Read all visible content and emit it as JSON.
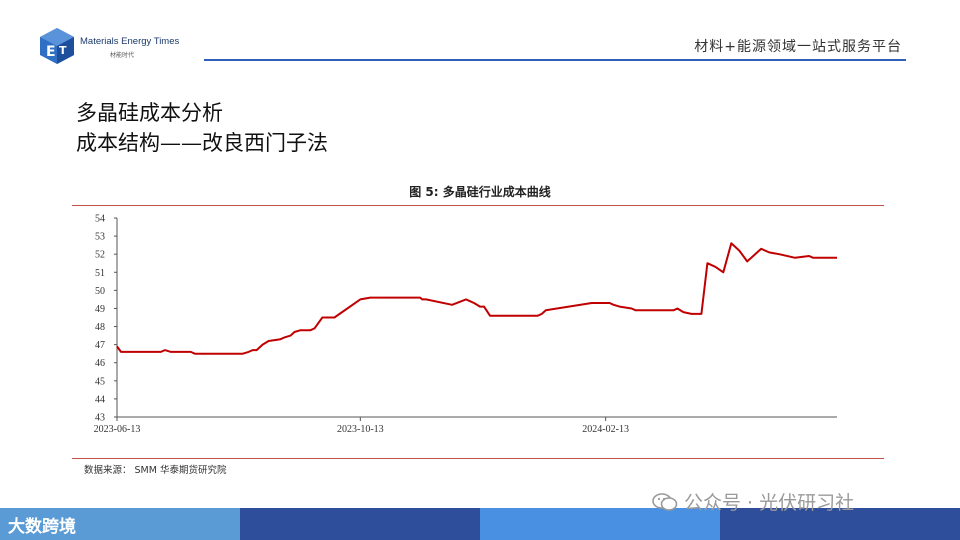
{
  "header": {
    "brand_en": "Materials Energy Times",
    "brand_cn": "材能时代",
    "tagline": "材料+能源领域一站式服务平台"
  },
  "slide": {
    "title_line1": "多晶硅成本分析",
    "title_line2": "成本结构——改良西门子法"
  },
  "footer": {
    "source": "数据来源：   SMM  华泰期货研究院",
    "logo_text": "大数跨境",
    "watermark": "公众号 · 光伏研习社"
  },
  "colors": {
    "series": "#c00000",
    "rule": "#c0504d",
    "brand_blue": "#2f5fb8"
  },
  "chart_data": {
    "type": "line",
    "title": "图  5:  多晶硅行业成本曲线",
    "ylim": [
      43,
      54
    ],
    "y_ticks": [
      43,
      44,
      45,
      46,
      47,
      48,
      49,
      50,
      51,
      52,
      53,
      54
    ],
    "x_tick_labels": [
      "2023-06-13",
      "2023-10-13",
      "2024-02-13"
    ],
    "x_range": [
      "2023-06-13",
      "2024-06-08"
    ],
    "series": [
      {
        "x": [
          "2023-06-13",
          "2023-06-15",
          "2023-06-16",
          "2023-07-05",
          "2023-07-07",
          "2023-07-10",
          "2023-07-20",
          "2023-07-22",
          "2023-08-15",
          "2023-08-18",
          "2023-08-20",
          "2023-08-22",
          "2023-08-25",
          "2023-08-28",
          "2023-09-03",
          "2023-09-05",
          "2023-09-08",
          "2023-09-10",
          "2023-09-13",
          "2023-09-15",
          "2023-09-18",
          "2023-09-20",
          "2023-09-22",
          "2023-09-24",
          "2023-09-30",
          "2023-10-13",
          "2023-10-18",
          "2023-10-24",
          "2023-10-26",
          "2023-10-28",
          "2023-10-30",
          "2023-11-01",
          "2023-11-04",
          "2023-11-06",
          "2023-11-12",
          "2023-11-13",
          "2023-11-15",
          "2023-11-28",
          "2023-12-05",
          "2023-12-07",
          "2023-12-09",
          "2023-12-12",
          "2023-12-14",
          "2023-12-17",
          "2023-12-30",
          "2024-01-03",
          "2024-01-07",
          "2024-01-10",
          "2024-01-12",
          "2024-01-14",
          "2024-02-06",
          "2024-02-08",
          "2024-02-11",
          "2024-02-13",
          "2024-02-15",
          "2024-02-17",
          "2024-02-20",
          "2024-02-26",
          "2024-02-28",
          "2024-03-01",
          "2024-03-05",
          "2024-03-06",
          "2024-03-08",
          "2024-03-10",
          "2024-03-13",
          "2024-03-15",
          "2024-03-18",
          "2024-03-20",
          "2024-03-23",
          "2024-03-27",
          "2024-04-01",
          "2024-04-04",
          "2024-04-08",
          "2024-04-12",
          "2024-04-16",
          "2024-04-20",
          "2024-04-24",
          "2024-05-01",
          "2024-05-05",
          "2024-05-10",
          "2024-05-18",
          "2024-05-25",
          "2024-05-27",
          "2024-06-08"
        ],
        "values": [
          46.9,
          46.6,
          46.6,
          46.6,
          46.7,
          46.6,
          46.6,
          46.5,
          46.5,
          46.6,
          46.7,
          46.7,
          47.0,
          47.2,
          47.3,
          47.4,
          47.5,
          47.7,
          47.8,
          47.8,
          47.8,
          47.9,
          48.2,
          48.5,
          48.5,
          49.5,
          49.6,
          49.6,
          49.6,
          49.6,
          49.6,
          49.6,
          49.6,
          49.6,
          49.6,
          49.5,
          49.5,
          49.2,
          49.5,
          49.4,
          49.3,
          49.1,
          49.1,
          48.6,
          48.6,
          48.6,
          48.6,
          48.6,
          48.7,
          48.9,
          49.3,
          49.3,
          49.3,
          49.3,
          49.3,
          49.2,
          49.1,
          49.0,
          48.9,
          48.9,
          48.9,
          48.9,
          48.9,
          48.9,
          48.9,
          48.9,
          48.9,
          49.0,
          48.8,
          48.7,
          48.7,
          51.5,
          51.3,
          51.0,
          52.6,
          52.2,
          51.6,
          52.3,
          52.1,
          52.0,
          51.8,
          51.9,
          51.8,
          51.8
        ]
      }
    ]
  }
}
